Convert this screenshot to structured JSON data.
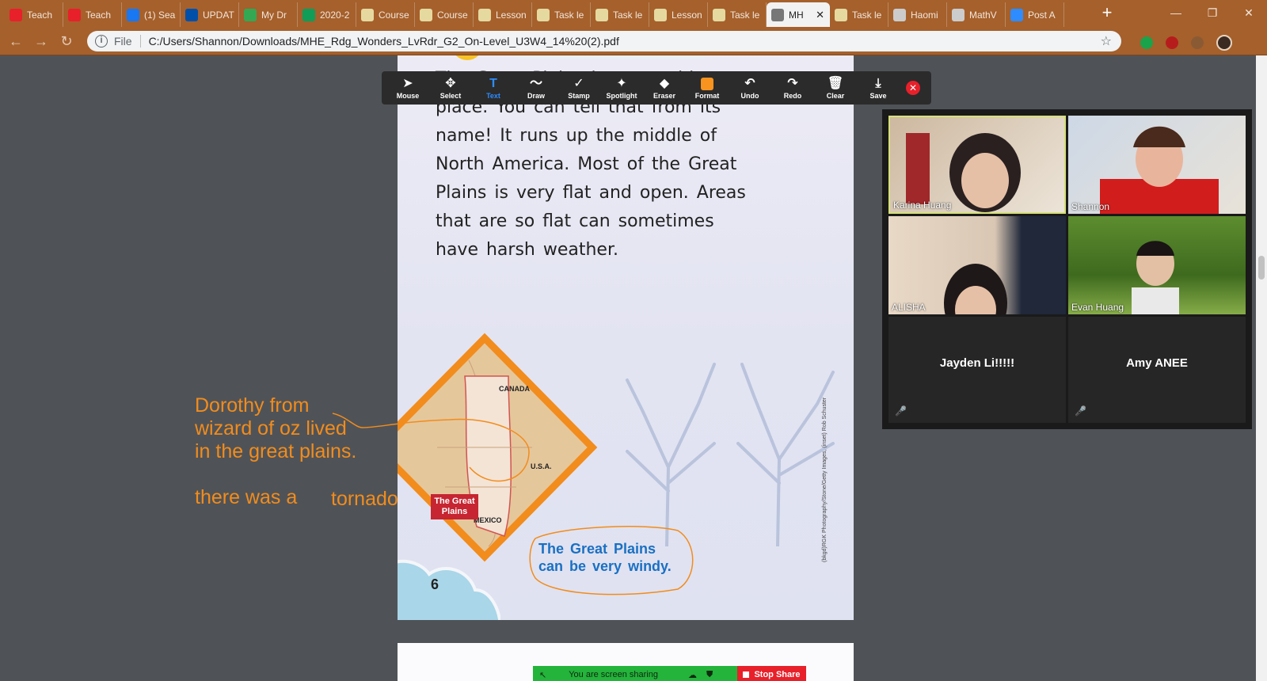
{
  "browser": {
    "tabs": [
      {
        "label": "Teach",
        "icon": "teach-icon",
        "color": "#e8202a"
      },
      {
        "label": "Teach",
        "icon": "teach-icon",
        "color": "#e8202a"
      },
      {
        "label": "(1) Sea",
        "icon": "facebook-icon",
        "color": "#1877f2"
      },
      {
        "label": "UPDAT",
        "icon": "lidl-icon",
        "color": "#0050aa"
      },
      {
        "label": "My Dr",
        "icon": "google-drive-icon",
        "color": "#34a853"
      },
      {
        "label": "2020-2",
        "icon": "google-sheets-icon",
        "color": "#0f9d58"
      },
      {
        "label": "Course",
        "icon": "document-icon",
        "color": "#e6d9a0"
      },
      {
        "label": "Course",
        "icon": "document-icon",
        "color": "#e6d9a0"
      },
      {
        "label": "Lesson",
        "icon": "document-icon",
        "color": "#e6d9a0"
      },
      {
        "label": "Task le",
        "icon": "document-icon",
        "color": "#e6d9a0"
      },
      {
        "label": "Task le",
        "icon": "document-icon",
        "color": "#e6d9a0"
      },
      {
        "label": "Lesson",
        "icon": "document-icon",
        "color": "#e6d9a0"
      },
      {
        "label": "Task le",
        "icon": "document-icon",
        "color": "#e6d9a0"
      },
      {
        "label": "MH",
        "icon": "globe-icon",
        "color": "#777777",
        "active": true
      },
      {
        "label": "Task le",
        "icon": "document-icon",
        "color": "#e6d9a0"
      },
      {
        "label": "Haomi",
        "icon": "globe-icon",
        "color": "#cccccc"
      },
      {
        "label": "MathV",
        "icon": "globe-icon",
        "color": "#cccccc"
      },
      {
        "label": "Post A",
        "icon": "zoom-icon",
        "color": "#2d8cff"
      }
    ],
    "omnibox_scheme": "File",
    "url": "C:/Users/Shannon/Downloads/MHE_Rdg_Wonders_LvRdr_G2_On-Level_U3W4_14%20(2).pdf"
  },
  "pdf": {
    "passage_lines": [
      "The Great Plains is a very big",
      "place. You can tell that from its",
      "name! It runs up the middle of",
      "North America. Most of the Great",
      "Plains is very flat and open. Areas",
      "that are so flat can sometimes",
      "have harsh weather."
    ],
    "map_labels": {
      "canada": "CANADA",
      "usa": "U.S.A.",
      "mexico": "MEXICO",
      "great_plains_1": "The Great",
      "great_plains_2": "Plains"
    },
    "caption_1": "The Great Plains",
    "caption_2": "can be very windy.",
    "page_number": "6",
    "credit": "(bkgd)RGK Photography/Stone/Getty Images, (inset) Rob Schuster"
  },
  "annotations": {
    "line1": "Dorothy from",
    "line2": "wizard of oz lived",
    "line3": "in the great plains.",
    "line4": "there was a",
    "line5": "tornado",
    "color": "#f28c1c"
  },
  "annotate_toolbar": {
    "tools": [
      {
        "label": "Mouse",
        "icon": "mouse-pointer-icon",
        "glyph": "➤"
      },
      {
        "label": "Select",
        "icon": "move-icon",
        "glyph": "✥"
      },
      {
        "label": "Text",
        "icon": "text-icon",
        "glyph": "T",
        "selected": true
      },
      {
        "label": "Draw",
        "icon": "draw-icon",
        "glyph": "〜"
      },
      {
        "label": "Stamp",
        "icon": "stamp-icon",
        "glyph": "✓"
      },
      {
        "label": "Spotlight",
        "icon": "spotlight-icon",
        "glyph": "✦"
      },
      {
        "label": "Eraser",
        "icon": "eraser-icon",
        "glyph": "◆"
      },
      {
        "label": "Format",
        "icon": "format-icon",
        "glyph": ""
      },
      {
        "label": "Undo",
        "icon": "undo-icon",
        "glyph": "↶"
      },
      {
        "label": "Redo",
        "icon": "redo-icon",
        "glyph": "↷"
      },
      {
        "label": "Clear",
        "icon": "trash-icon",
        "glyph": "🗑"
      },
      {
        "label": "Save",
        "icon": "save-icon",
        "glyph": "⤓"
      }
    ],
    "accent": "#2d8cff",
    "format_color": "#f7931e"
  },
  "participants": [
    {
      "name": "Karina Huang",
      "video": true,
      "highlight": true
    },
    {
      "name": "Shannon",
      "video": true
    },
    {
      "name": "ALISHA",
      "video": true
    },
    {
      "name": "Evan Huang",
      "video": true
    },
    {
      "name": "Jayden Li!!!!!",
      "video": false,
      "muted": true
    },
    {
      "name": "Amy ANEE",
      "video": false,
      "muted": true
    }
  ],
  "share_bar": {
    "status": "You are screen sharing",
    "stop_label": "Stop Share"
  }
}
